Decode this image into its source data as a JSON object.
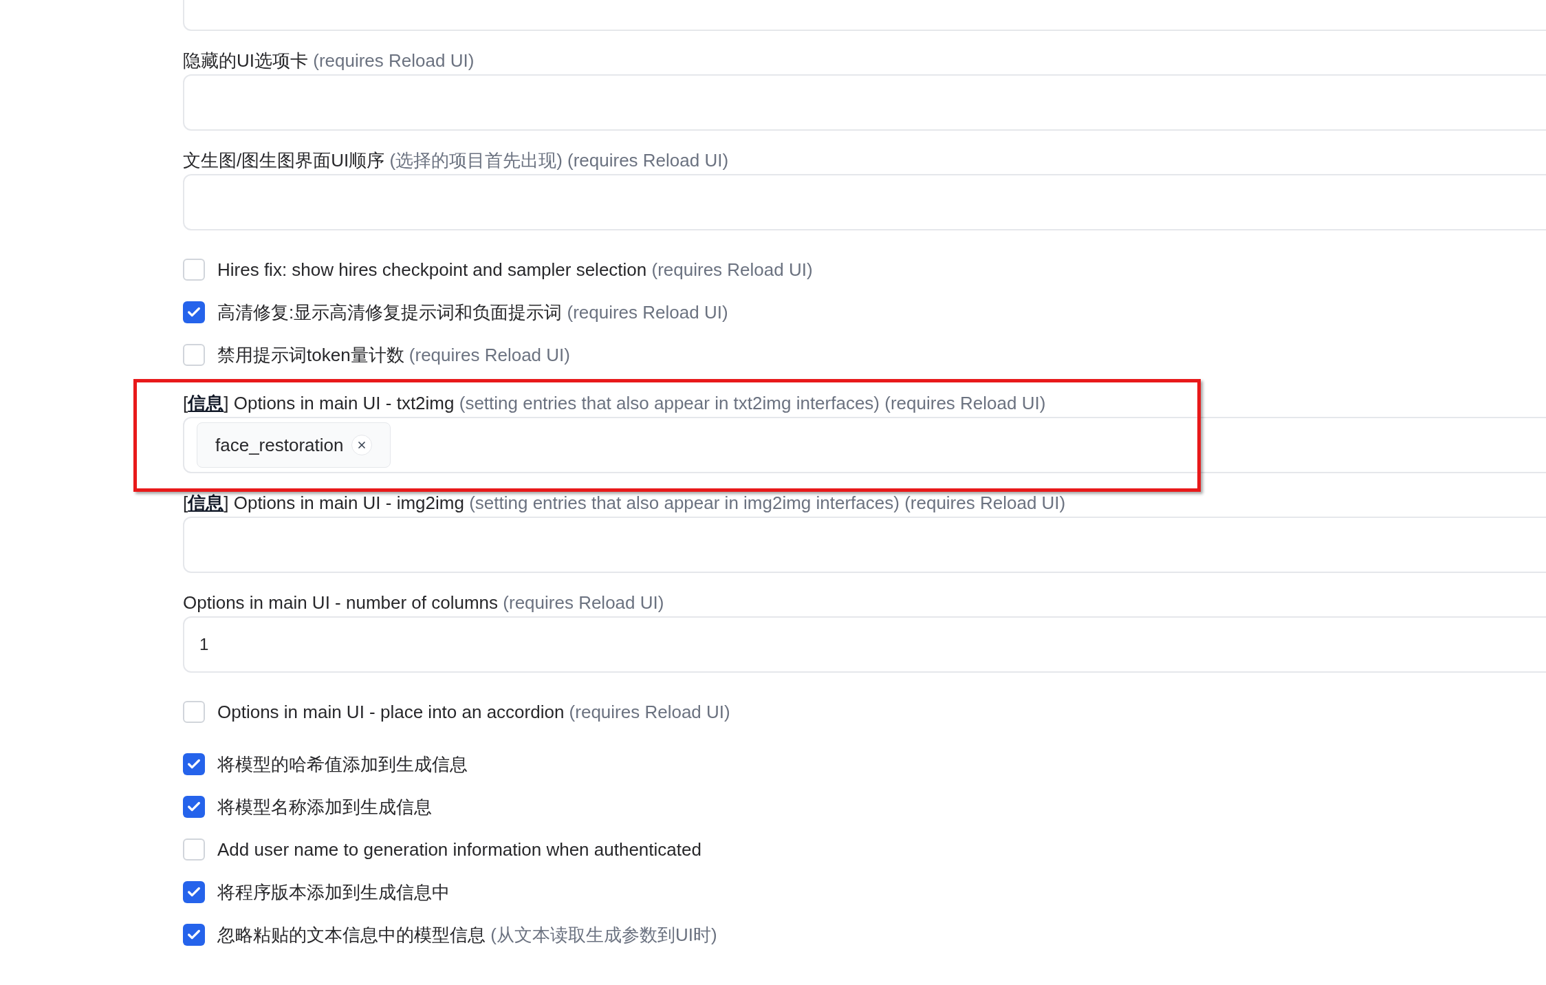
{
  "sections": [
    {
      "items": [
        {
          "kind": "field"
        },
        {
          "kind": "field",
          "label": "隐藏的UI选项卡",
          "hint": "(requires Reload UI)"
        },
        {
          "kind": "field",
          "label": "文生图/图生图界面UI顺序",
          "hint": "(选择的项目首先出现) (requires Reload UI)"
        },
        {
          "kind": "checkbox",
          "label": "Hires fix: show hires checkpoint and sampler selection",
          "hint": "(requires Reload UI)",
          "checked": false
        },
        {
          "kind": "checkbox",
          "label": "高清修复:显示高清修复提示词和负面提示词",
          "hint": "(requires Reload UI)",
          "checked": true
        },
        {
          "kind": "checkbox",
          "label": "禁用提示词token量计数",
          "hint": "(requires Reload UI)",
          "checked": false
        },
        {
          "kind": "field",
          "open": "[",
          "info": "信息",
          "close": "]",
          "label": "Options in main UI - txt2img",
          "hint": "(setting entries that also appear in txt2img interfaces) (requires Reload UI)",
          "tags": [
            "face_restoration"
          ],
          "highlighted": true
        },
        {
          "kind": "field",
          "open": "[",
          "info": "信息",
          "close": "]",
          "label": "Options in main UI - img2img",
          "hint": "(setting entries that also appear in img2img interfaces) (requires Reload UI)",
          "highlighted": false
        },
        {
          "kind": "field",
          "label": "Options in main UI - number of columns",
          "hint": "(requires Reload UI)",
          "value": "1"
        },
        {
          "kind": "checkbox",
          "label": "Options in main UI - place into an accordion",
          "hint": "(requires Reload UI)",
          "checked": false
        }
      ]
    },
    {
      "items": [
        {
          "kind": "checkbox",
          "label": "将模型的哈希值添加到生成信息",
          "checked": true
        },
        {
          "kind": "checkbox",
          "label": "将模型名称添加到生成信息",
          "checked": true
        },
        {
          "kind": "checkbox",
          "label": "Add user name to generation information when authenticated",
          "checked": false
        },
        {
          "kind": "checkbox",
          "label": "将程序版本添加到生成信息中",
          "checked": true
        },
        {
          "kind": "checkbox",
          "label": "忽略粘贴的文本信息中的模型信息",
          "hint": "(从文本读取生成参数到UI时)",
          "checked": true
        }
      ]
    }
  ]
}
